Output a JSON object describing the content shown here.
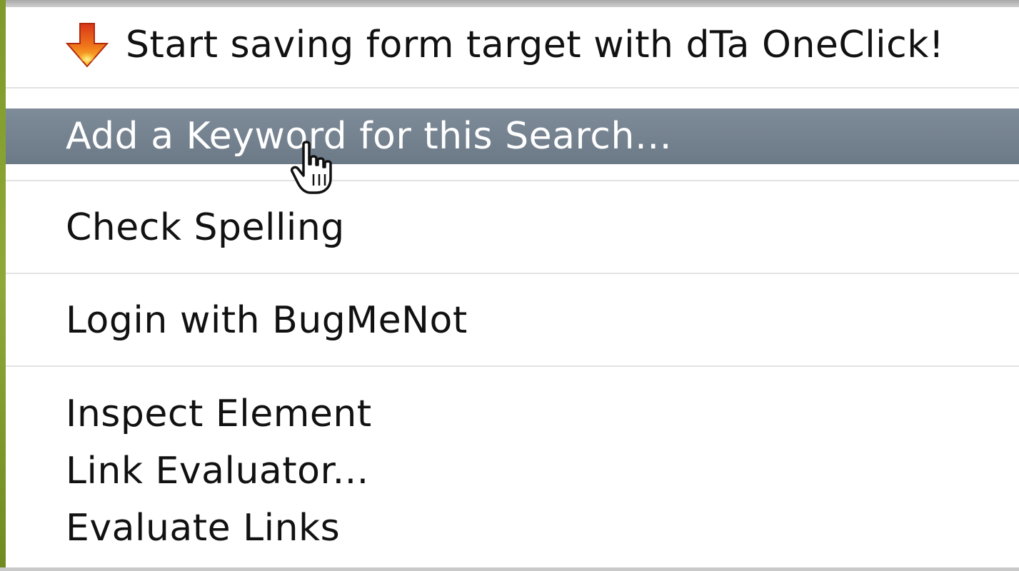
{
  "menu": {
    "items": [
      {
        "label": "Start saving form target with dTa OneClick!",
        "icon": "dta-oneclick-icon"
      },
      {
        "label": "Add a Keyword for this Search…",
        "highlighted": true
      },
      {
        "label": "Check Spelling"
      },
      {
        "label": "Login with BugMeNot"
      },
      {
        "label": "Inspect Element"
      },
      {
        "label": "Link Evaluator..."
      },
      {
        "label": "Evaluate Links"
      }
    ]
  },
  "colors": {
    "highlight": "#75828f",
    "text": "#111111",
    "highlight_text": "#ffffff",
    "separator": "#e3e3e3"
  },
  "cursor": {
    "icon": "hand-pointer-icon"
  }
}
